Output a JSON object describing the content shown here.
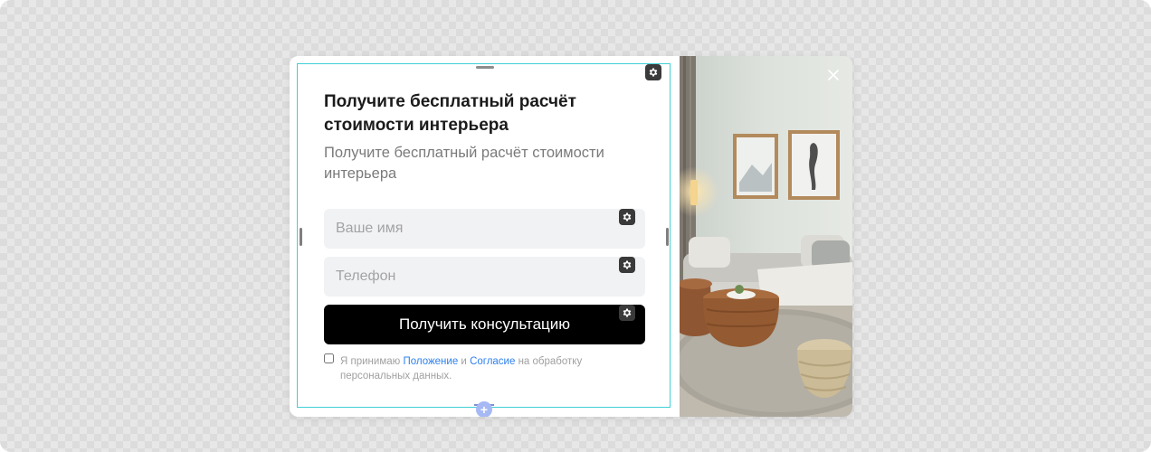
{
  "popup": {
    "title": "Получите бесплатный расчёт стоимости интерьера",
    "subtitle": "Получите бесплатный расчёт стоимости интерьера",
    "fields": {
      "name_placeholder": "Ваше имя",
      "phone_placeholder": "Телефон"
    },
    "submit_label": "Получить консультацию",
    "consent": {
      "prefix": "Я принимаю ",
      "link_regulation": "Положение",
      "joiner": " и ",
      "link_agreement": "Согласие",
      "suffix": " на обработку персональных данных.",
      "checked": false
    }
  },
  "editor": {
    "gear_icon": "gear-icon",
    "close_icon": "close-icon",
    "add_icon": "plus-icon",
    "add_symbol": "+",
    "selection_color": "#3fcfd6"
  },
  "colors": {
    "button_bg": "#000000",
    "link": "#2f80ed",
    "field_bg": "#f1f2f4"
  }
}
